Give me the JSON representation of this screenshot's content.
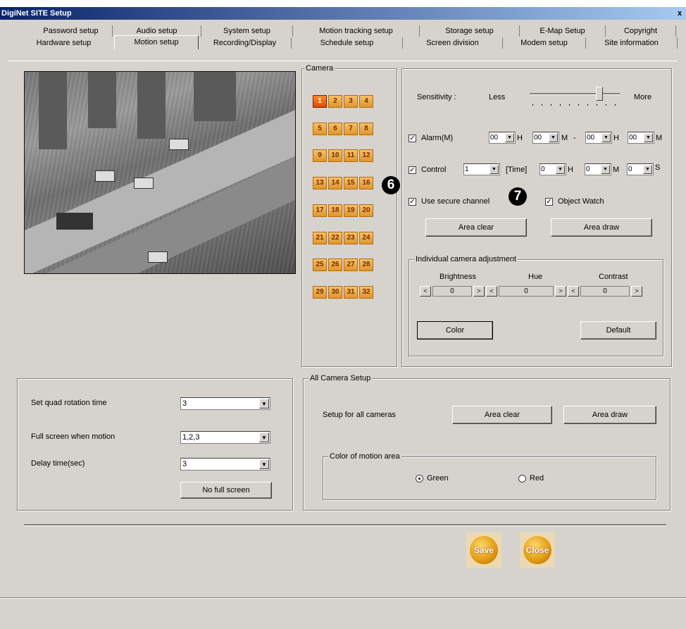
{
  "window": {
    "title": "DigiNet SITE Setup",
    "close_label": "x"
  },
  "tabs_row1": [
    "Password setup",
    "Audio setup",
    "System setup",
    "Motion tracking setup",
    "Storage setup",
    "E-Map Setup",
    "Copyright"
  ],
  "tabs_row2": [
    "Hardware setup",
    "Motion setup",
    "Recording/Display",
    "Schedule setup",
    "Screen division",
    "Modem setup",
    "Site information"
  ],
  "active_tab": "Motion setup",
  "camera": {
    "group_label": "Camera",
    "numbers": [
      "1",
      "2",
      "3",
      "4",
      "5",
      "6",
      "7",
      "8",
      "9",
      "10",
      "11",
      "12",
      "13",
      "14",
      "15",
      "16",
      "17",
      "18",
      "19",
      "20",
      "21",
      "22",
      "23",
      "24",
      "25",
      "26",
      "27",
      "28",
      "29",
      "30",
      "31",
      "32"
    ],
    "selected": "1"
  },
  "sensitivity": {
    "label": "Sensitivity :",
    "less": "Less",
    "more": "More",
    "level": 0.8
  },
  "alarm": {
    "label": "Alarm(M)",
    "checked": true,
    "h1": "00",
    "m1": "00",
    "h2": "00",
    "m2": "00",
    "h_unit": "H",
    "m_unit": "M",
    "dash": "-"
  },
  "control": {
    "label": "Control",
    "checked": true,
    "value": "1",
    "time_label": "[Time]",
    "h": "0",
    "m": "0",
    "s": "0",
    "h_unit": "H",
    "m_unit": "M",
    "s_unit": "S"
  },
  "secure_channel": {
    "label": "Use secure channel",
    "checked": true
  },
  "object_watch": {
    "label": "Object Watch",
    "checked": true
  },
  "callouts": {
    "six": "6",
    "seven": "7"
  },
  "buttons": {
    "area_clear": "Area clear",
    "area_draw": "Area draw",
    "color": "Color",
    "default": "Default",
    "all_area_clear": "Area clear",
    "all_area_draw": "Area draw",
    "no_full_screen": "No full screen",
    "save": "Save",
    "close": "Close"
  },
  "adjust": {
    "group_label": "Individual camera adjustment",
    "brightness_label": "Brightness",
    "hue_label": "Hue",
    "contrast_label": "Contrast",
    "brightness": "0",
    "hue": "0",
    "contrast": "0",
    "dec": "<",
    "inc": ">"
  },
  "quad": {
    "rotation_label": "Set quad rotation time",
    "rotation_value": "3",
    "fullscreen_label": "Full screen when motion",
    "fullscreen_value": "1,2,3",
    "delay_label": "Delay time(sec)",
    "delay_value": "3"
  },
  "all_camera": {
    "group_label": "All Camera Setup",
    "setup_label": "Setup for all cameras",
    "color_group_label": "Color of motion area",
    "green": "Green",
    "red": "Red",
    "selected": "Green"
  }
}
